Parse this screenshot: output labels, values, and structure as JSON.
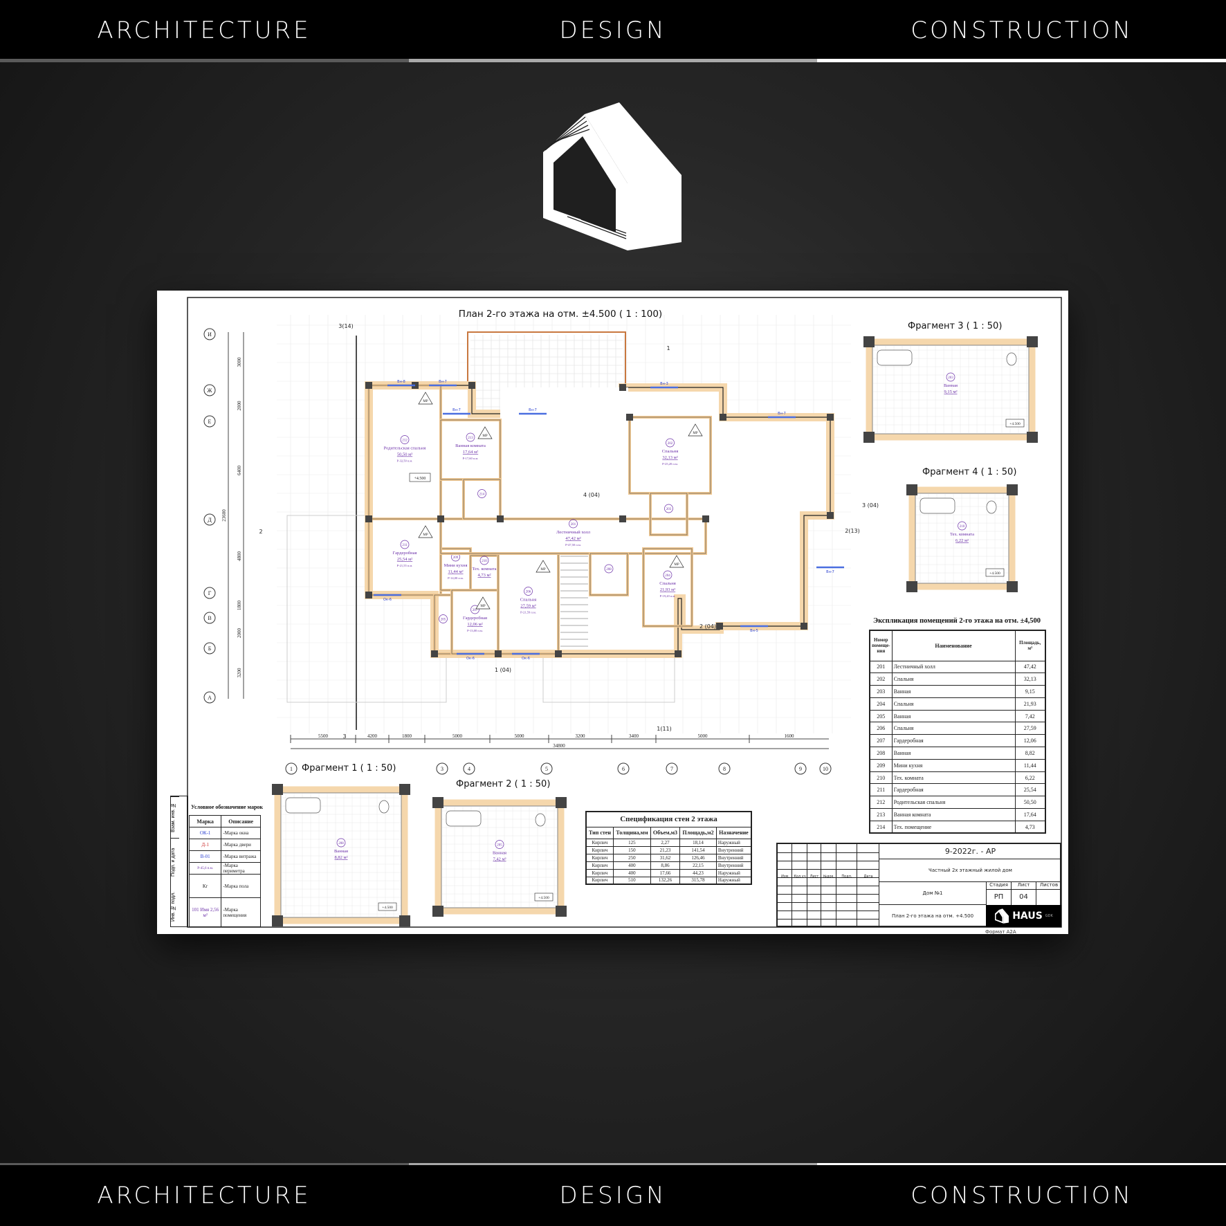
{
  "header": {
    "items": [
      "ARCHITECTURE",
      "DESIGN",
      "CONSTRUCTION"
    ]
  },
  "footer": {
    "items": [
      "ARCHITECTURE",
      "DESIGN",
      "CONSTRUCTION"
    ]
  },
  "colors": {
    "background": "#1e1e1e",
    "band": "#000000",
    "wall_fill": "#f5d7ac",
    "room_label": "#6b2fa8",
    "window_mark": "#2a3fd0",
    "door_mark": "#cc2b2b"
  },
  "logo": {
    "icon": "house-logo-icon"
  },
  "drawing": {
    "plan_title": "План  2-го этажа на отм. ±4.500 ( 1 : 100)",
    "axes_letters": [
      "И",
      "Ж",
      "Е",
      "Д",
      "Г",
      "В",
      "Б",
      "А"
    ],
    "axes_numbers": [
      "1",
      "3",
      "4",
      "5",
      "6",
      "7",
      "8",
      "9",
      "10"
    ],
    "bottom_dims": [
      "5500",
      "4200",
      "1800",
      "5000",
      "5000",
      "3200",
      "3400",
      "5000",
      "1600"
    ],
    "bottom_total": "34800",
    "left_dims": [
      "3000",
      "2000",
      "6400",
      "4800",
      "1800",
      "2000",
      "3200"
    ],
    "left_total": "23600",
    "sections": [
      "3(14)",
      "1",
      "4 (04)",
      "3 (04)",
      "2(13)",
      "2",
      "2 (04)",
      "1 (04)",
      "1(11)",
      "3"
    ],
    "level_mark": "+4.500",
    "floor_mark": "МР",
    "rooms": [
      {
        "num": "212",
        "name": "Родительская спальня",
        "area": "50,50 м²",
        "perim": "Р-32,50 п.м."
      },
      {
        "num": "213",
        "name": "Ванная комната",
        "area": "17,64 м²",
        "perim": "Р-17,60 п.м."
      },
      {
        "num": "211",
        "name": "Гардеробная",
        "area": "25,54 м²",
        "perim": "Р-21,55 п.м."
      },
      {
        "num": "209",
        "name": "Мини кухня",
        "area": "11,44 м²",
        "perim": "Р-14,00 п.м."
      },
      {
        "num": "210",
        "name": "Тех. комната",
        "area": "4,73 м²",
        "perim": ""
      },
      {
        "num": "205",
        "name": "",
        "area": "",
        "perim": ""
      },
      {
        "num": "207",
        "name": "Гардеробная",
        "area": "12,06 м²",
        "perim": "Р-13,00 п.м."
      },
      {
        "num": "206",
        "name": "Спальня",
        "area": "27,59 м²",
        "perim": "Р-21,59 п.м."
      },
      {
        "num": "201",
        "name": "Лестничный холл",
        "area": "47,42 м²",
        "perim": "Р-47,50 п.м."
      },
      {
        "num": "202",
        "name": "Спальня",
        "area": "32,13 м²",
        "perim": "Р-25,20 п.м."
      },
      {
        "num": "204",
        "name": "Спальня",
        "area": "21,93 м²",
        "perim": "Р-19,20 п.м."
      },
      {
        "num": "203",
        "name": "",
        "area": "",
        "perim": ""
      },
      {
        "num": "214",
        "name": "",
        "area": "",
        "perim": ""
      },
      {
        "num": "208",
        "name": "",
        "area": "",
        "perim": ""
      }
    ],
    "window_marks": [
      "Вн-8",
      "Вн-7",
      "Вн-7",
      "Вн-3",
      "Вн-7",
      "Ок-6",
      "Ок-6",
      "Ок-6",
      "Вн-5",
      "Вн-7",
      "Вн-7"
    ],
    "fragments": [
      {
        "title": "Фрагмент 3 ( 1 : 50)",
        "room": "203",
        "name": "Ванная",
        "area": "9,15 м²",
        "level": "+4.500"
      },
      {
        "title": "Фрагмент 4 ( 1 : 50)",
        "room": "210",
        "name": "Тех. комната",
        "area": "6,22 м²",
        "level": "+4.500"
      },
      {
        "title": "Фрагмент 1 ( 1 : 50)",
        "room": "208",
        "name": "Ванная",
        "area": "8,82 м²",
        "level": "+4.500"
      },
      {
        "title": "Фрагмент 2 ( 1 : 50)",
        "room": "205",
        "name": "Ванная",
        "area": "7,42 м²",
        "level": "+4.500"
      }
    ]
  },
  "explication": {
    "title": "Экспликация помещений  2-го этажа на отм. ±4,500",
    "headers": [
      "Номер помеще-ния",
      "Наименование",
      "Площадь, м²"
    ],
    "rows": [
      [
        "201",
        "Лестничный  холл",
        "47,42"
      ],
      [
        "202",
        "Спальня",
        "32,13"
      ],
      [
        "203",
        "Ванная",
        "9,15"
      ],
      [
        "204",
        "Спальня",
        "21,93"
      ],
      [
        "205",
        "Ванная",
        "7,42"
      ],
      [
        "206",
        "Спальня",
        "27,59"
      ],
      [
        "207",
        "Гардеробная",
        "12,06"
      ],
      [
        "208",
        "Ванная",
        "8,82"
      ],
      [
        "209",
        "Мини кухня",
        "11,44"
      ],
      [
        "210",
        "Тех. комната",
        "6,22"
      ],
      [
        "211",
        "Гардеробная",
        "25,54"
      ],
      [
        "212",
        "Родительская  спальня",
        "50,50"
      ],
      [
        "213",
        "Ванная  комната",
        "17,64"
      ],
      [
        "214",
        "Тех. помещение",
        "4,73"
      ]
    ]
  },
  "walls_spec": {
    "title": "Спецификация стен 2 этажа",
    "headers": [
      "Тип стен",
      "Толщина,мм",
      "Объем,м3",
      "Площадь,м2",
      "Назначение"
    ],
    "rows": [
      [
        "Кирпич",
        "125",
        "2,27",
        "18,14",
        "Наружный"
      ],
      [
        "Кирпич",
        "150",
        "21,23",
        "141,54",
        "Внутренний"
      ],
      [
        "Кирпич",
        "250",
        "31,62",
        "126,46",
        "Внутренний"
      ],
      [
        "Кирпич",
        "400",
        "8,86",
        "22,15",
        "Внутренний"
      ],
      [
        "Кирпич",
        "400",
        "17,66",
        "44,23",
        "Наружный"
      ],
      [
        "Кирпич",
        "510",
        "132,26",
        "315,78",
        "Наружный"
      ]
    ]
  },
  "legend": {
    "title": "Условное обозначение марок",
    "headers": [
      "Марка",
      "Описание"
    ],
    "rows": [
      [
        "ОК-1",
        "-Марка окна"
      ],
      [
        "Д-1",
        "-Марка двери"
      ],
      [
        "В-01",
        "-Марка витража"
      ],
      [
        "Р-45,6 п.м.",
        "-Марка периметра"
      ],
      [
        "Кг",
        "-Марка пола"
      ],
      [
        "101 Имя 2,56 м²",
        "-Марка помещения"
      ]
    ],
    "stamp_cols": [
      "Взам. инв. №",
      "Подп. и дата",
      "Инв. № подл."
    ]
  },
  "title_block": {
    "code": "9-2022г. - АР",
    "project": "Частный 2х этажный жилой дом",
    "object": "Дом №1",
    "sheet_name": "План 2-го этажа на отм. +4.500",
    "col_headers": [
      "Изм.",
      "Кол.уч",
      "Лист",
      "№док.",
      "Подп.",
      "Дата"
    ],
    "stage_headers": [
      "Стадия",
      "Лист",
      "Листов"
    ],
    "stage": "РП",
    "sheet": "04",
    "sheets": "",
    "brand": "HAUS",
    "brand_sub": "GDK",
    "format": "Формат А2А"
  }
}
